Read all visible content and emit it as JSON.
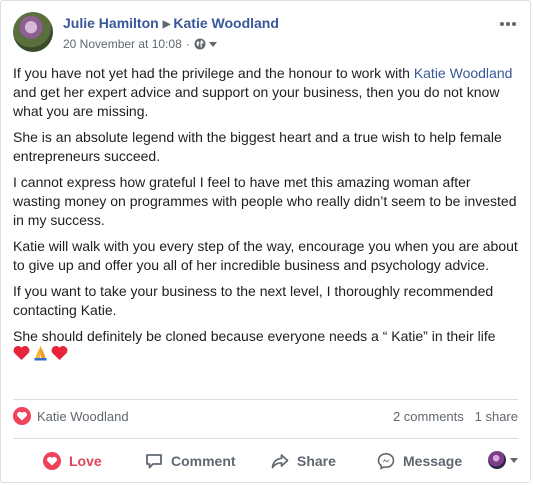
{
  "post": {
    "author": "Julie Hamilton",
    "target": "Katie Woodland",
    "timestamp": "20 November at 10:08",
    "separator": "·",
    "privacy_icon": "globe-icon",
    "menu_icon": "more-dots-icon"
  },
  "body": {
    "p1_before": "If you have not yet had the privilege and the honour to work with ",
    "p1_mention": "Katie Woodland",
    "p1_after": " and get her expert advice and support on your business, then you do not know what you are missing.",
    "p2": "She is an absolute legend with the biggest heart and a true wish to help female entrepreneurs succeed.",
    "p3": "I cannot express how grateful I feel to have met this amazing woman after wasting money on programmes with people who really didn’t seem to be invested in my success.",
    "p4": "Katie will walk with you every step of the way, encourage you when you are about to give up and offer you all of her incredible business and psychology advice.",
    "p5": "If you want to take your business to the next level, I thoroughly recommended contacting Katie.",
    "p6": "She should definitely be cloned because everyone needs a “ Katie” in their life",
    "emojis": [
      "heart-emoji",
      "praying-hands-emoji",
      "heart-emoji"
    ]
  },
  "reactions": {
    "icon": "love-reaction-icon",
    "name": "Katie Woodland",
    "comments": "2 comments",
    "shares": "1 share"
  },
  "actions": {
    "love": "Love",
    "comment": "Comment",
    "share": "Share",
    "message": "Message"
  },
  "colors": {
    "link": "#385898",
    "secondary_text": "#606770",
    "love": "#e0455a",
    "divider": "#dadde1"
  }
}
